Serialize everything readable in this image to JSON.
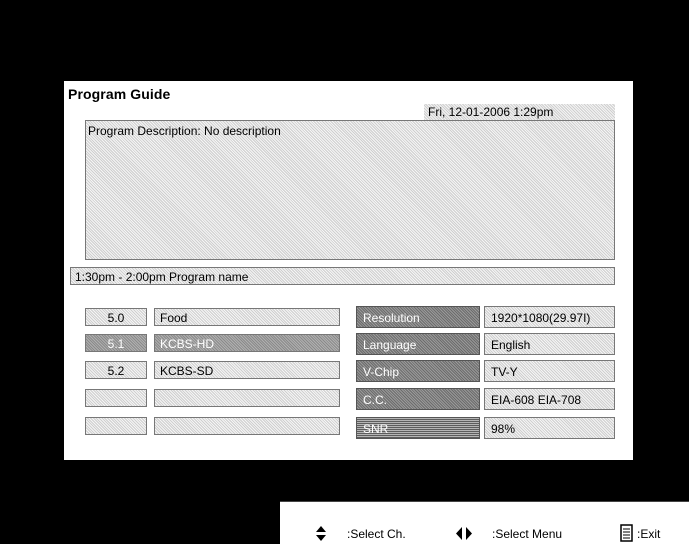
{
  "guide": {
    "title": "Program Guide",
    "datetime": "Fri, 12-01-2006  1:29pm",
    "description": "Program Description: No description",
    "time_slot": "1:30pm - 2:00pm  Program name"
  },
  "channels": [
    {
      "number": "5.0",
      "name": "Food",
      "selected": false
    },
    {
      "number": "5.1",
      "name": "KCBS-HD",
      "selected": true
    },
    {
      "number": "5.2",
      "name": "KCBS-SD",
      "selected": false
    },
    {
      "number": "",
      "name": "",
      "selected": false
    },
    {
      "number": "",
      "name": "",
      "selected": false
    }
  ],
  "info": [
    {
      "label": "Resolution",
      "value": "1920*1080(29.97I)"
    },
    {
      "label": "Language",
      "value": "English"
    },
    {
      "label": "V-Chip",
      "value": "TV-Y"
    },
    {
      "label": "C.C.",
      "value": "EIA-608 EIA-708"
    },
    {
      "label": "SNR",
      "value": "98%"
    }
  ],
  "help": {
    "select_channel": ":Select Ch.",
    "select_menu": ":Select Menu",
    "exit": ":Exit",
    "icons": [
      "up-down-arrow-icon",
      "left-right-arrow-icon",
      "menu-guide-icon"
    ]
  },
  "colors": {
    "background": "#000000",
    "panel": "#ffffff",
    "selected": "#9a9a9a",
    "label": "#7c7c7c"
  }
}
